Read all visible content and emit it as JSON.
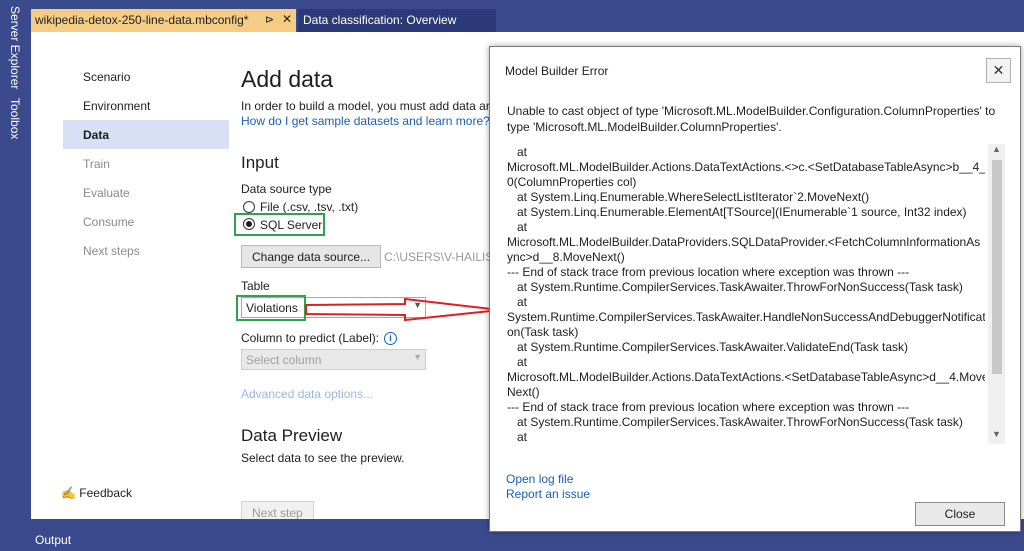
{
  "side_toolbar": {
    "server_explorer": "Server Explorer",
    "toolbox": "Toolbox"
  },
  "tabs": [
    {
      "label": "wikipedia-detox-250-line-data.mbconfig*",
      "pin_icon": "pin-icon",
      "close_icon": "close-icon"
    },
    {
      "label": "Data classification: Overview"
    }
  ],
  "nav": {
    "items": [
      "Scenario",
      "Environment",
      "Data",
      "Train",
      "Evaluate",
      "Consume",
      "Next steps"
    ],
    "feedback": "Feedback"
  },
  "main": {
    "title": "Add data",
    "intro": "In order to build a model, you must add data ar",
    "sample_link": "How do I get sample datasets and learn more?",
    "input_heading": "Input",
    "data_source_label": "Data source type",
    "option_file": "File (.csv, .tsv, .txt)",
    "option_sql": "SQL Server",
    "change_source_button": "Change data source...",
    "source_path": "C:\\USERS\\V-HAILISH",
    "table_label": "Table",
    "table_value": "Violations",
    "column_label": "Column to predict (Label):",
    "column_placeholder": "Select column",
    "advanced_link": "Advanced data options...",
    "preview_heading": "Data Preview",
    "preview_text": "Select data to see the preview.",
    "next_step_button": "Next step"
  },
  "output_bar": {
    "label": "Output"
  },
  "dialog": {
    "title": "Model Builder Error",
    "message": "Unable to cast object of type 'Microsoft.ML.ModelBuilder.Configuration.ColumnProperties' to type 'Microsoft.ML.ModelBuilder.ColumnProperties'.",
    "trace": [
      "   at",
      "Microsoft.ML.ModelBuilder.Actions.DataTextActions.<>c.<SetDatabaseTableAsync>b__4_",
      "0(ColumnProperties col)",
      "   at System.Linq.Enumerable.WhereSelectListIterator`2.MoveNext()",
      "   at System.Linq.Enumerable.ElementAt[TSource](IEnumerable`1 source, Int32 index)",
      "   at",
      "Microsoft.ML.ModelBuilder.DataProviders.SQLDataProvider.<FetchColumnInformationAs",
      "ync>d__8.MoveNext()",
      "--- End of stack trace from previous location where exception was thrown ---",
      "   at System.Runtime.CompilerServices.TaskAwaiter.ThrowForNonSuccess(Task task)",
      "   at",
      "System.Runtime.CompilerServices.TaskAwaiter.HandleNonSuccessAndDebuggerNotificati",
      "on(Task task)",
      "   at System.Runtime.CompilerServices.TaskAwaiter.ValidateEnd(Task task)",
      "   at",
      "Microsoft.ML.ModelBuilder.Actions.DataTextActions.<SetDatabaseTableAsync>d__4.Move",
      "Next()",
      "--- End of stack trace from previous location where exception was thrown ---",
      "   at System.Runtime.CompilerServices.TaskAwaiter.ThrowForNonSuccess(Task task)",
      "   at"
    ],
    "open_log_link": "Open log file",
    "report_link": "Report an issue",
    "close_button": "Close",
    "close_icon": "close-icon"
  },
  "colors": {
    "chrome": "#3b4a8c",
    "active_tab": "#f5cc84",
    "nav_selected": "#d7e0f5",
    "highlight_box": "#2fa34a",
    "annotation_arrow": "#e02020",
    "link": "#1a5fb4"
  }
}
